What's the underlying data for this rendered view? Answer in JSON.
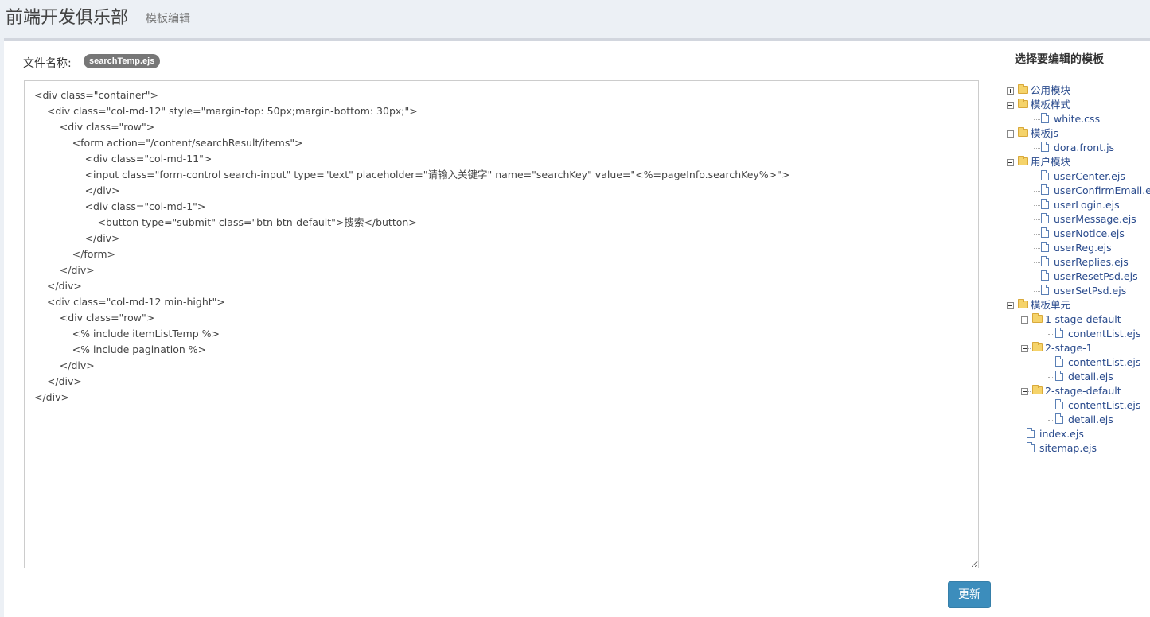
{
  "header": {
    "title": "前端开发俱乐部",
    "subtitle": "模板编辑"
  },
  "editor": {
    "file_label": "文件名称:",
    "file_name": "searchTemp.ejs",
    "content": "<div class=\"container\">\n    <div class=\"col-md-12\" style=\"margin-top: 50px;margin-bottom: 30px;\">\n        <div class=\"row\">\n            <form action=\"/content/searchResult/items\">\n                <div class=\"col-md-11\">\n                <input class=\"form-control search-input\" type=\"text\" placeholder=\"请输入关键字\" name=\"searchKey\" value=\"<%=pageInfo.searchKey%>\">\n                </div>\n                <div class=\"col-md-1\">\n                    <button type=\"submit\" class=\"btn btn-default\">搜索</button>\n                </div>\n            </form>\n        </div>\n    </div>\n    <div class=\"col-md-12 min-hight\">\n        <div class=\"row\">\n            <% include itemListTemp %>\n            <% include pagination %>\n        </div>\n    </div>\n</div>",
    "update_button": "更新"
  },
  "sidebar": {
    "title": "选择要编辑的模板",
    "tree": [
      {
        "type": "folder",
        "label": "公用模块",
        "depth": 0,
        "expanded": false
      },
      {
        "type": "folder",
        "label": "模板样式",
        "depth": 0,
        "expanded": true
      },
      {
        "type": "file",
        "label": "white.css",
        "depth": 1
      },
      {
        "type": "folder",
        "label": "模板js",
        "depth": 0,
        "expanded": true
      },
      {
        "type": "file",
        "label": "dora.front.js",
        "depth": 1
      },
      {
        "type": "folder",
        "label": "用户模块",
        "depth": 0,
        "expanded": true
      },
      {
        "type": "file",
        "label": "userCenter.ejs",
        "depth": 1
      },
      {
        "type": "file",
        "label": "userConfirmEmail.ejs",
        "depth": 1
      },
      {
        "type": "file",
        "label": "userLogin.ejs",
        "depth": 1
      },
      {
        "type": "file",
        "label": "userMessage.ejs",
        "depth": 1
      },
      {
        "type": "file",
        "label": "userNotice.ejs",
        "depth": 1
      },
      {
        "type": "file",
        "label": "userReg.ejs",
        "depth": 1
      },
      {
        "type": "file",
        "label": "userReplies.ejs",
        "depth": 1
      },
      {
        "type": "file",
        "label": "userResetPsd.ejs",
        "depth": 1
      },
      {
        "type": "file",
        "label": "userSetPsd.ejs",
        "depth": 1
      },
      {
        "type": "folder",
        "label": "模板单元",
        "depth": 0,
        "expanded": true
      },
      {
        "type": "folder",
        "label": "1-stage-default",
        "depth": 1,
        "expanded": true
      },
      {
        "type": "file",
        "label": "contentList.ejs",
        "depth": 2
      },
      {
        "type": "folder",
        "label": "2-stage-1",
        "depth": 1,
        "expanded": true
      },
      {
        "type": "file",
        "label": "contentList.ejs",
        "depth": 2
      },
      {
        "type": "file",
        "label": "detail.ejs",
        "depth": 2
      },
      {
        "type": "folder",
        "label": "2-stage-default",
        "depth": 1,
        "expanded": true
      },
      {
        "type": "file",
        "label": "contentList.ejs",
        "depth": 2
      },
      {
        "type": "file",
        "label": "detail.ejs",
        "depth": 2
      },
      {
        "type": "file",
        "label": "index.ejs",
        "depth": 0
      },
      {
        "type": "file",
        "label": "sitemap.ejs",
        "depth": 0
      }
    ]
  }
}
